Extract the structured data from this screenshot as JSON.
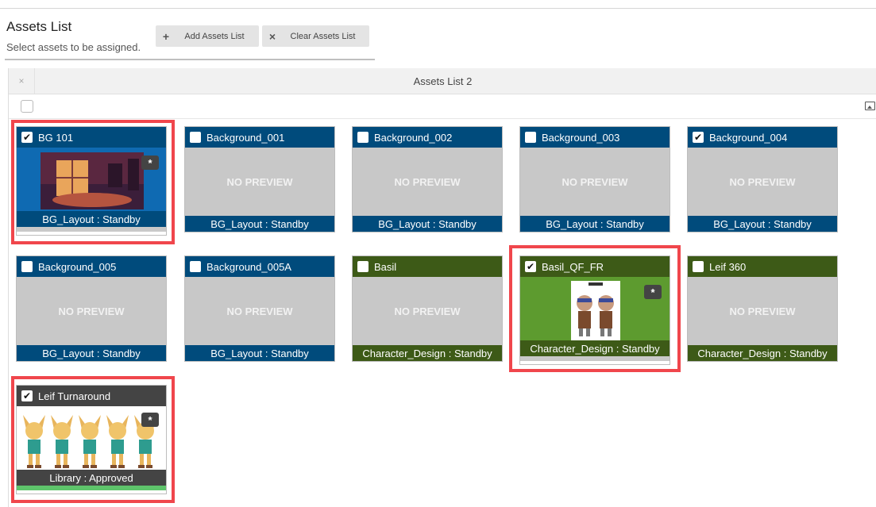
{
  "header": {
    "title": "Assets List",
    "subtitle": "Select assets to be assigned."
  },
  "buttons": {
    "add": {
      "icon": "plus-icon",
      "label": "Add Assets List"
    },
    "clear": {
      "icon": "close-icon",
      "label": "Clear Assets List"
    }
  },
  "panel": {
    "close_glyph": "×",
    "title": "Assets List 2"
  },
  "colors": {
    "background_group": "#004b7c",
    "character_group": "#3d5a17",
    "library_group": "#444444",
    "selection_highlight": "#f0464c",
    "approved_bar": "#5ec46b",
    "no_preview_bg": "#c8c8c8"
  },
  "no_preview_text": "NO PREVIEW",
  "star_glyph": "*",
  "check_glyph": "✔",
  "cards": [
    {
      "name": "BG 101",
      "status": "BG_Layout : Standby",
      "checked": true,
      "preview": "image",
      "highlighted": true
    },
    {
      "name": "Background_001",
      "status": "BG_Layout : Standby",
      "checked": false,
      "preview": "none"
    },
    {
      "name": "Background_002",
      "status": "BG_Layout : Standby",
      "checked": false,
      "preview": "none"
    },
    {
      "name": "Background_003",
      "status": "BG_Layout : Standby",
      "checked": false,
      "preview": "none"
    },
    {
      "name": "Background_004",
      "status": "BG_Layout : Standby",
      "checked": true,
      "preview": "none"
    },
    {
      "name": "Background_005",
      "status": "BG_Layout : Standby",
      "checked": false,
      "preview": "none"
    },
    {
      "name": "Background_005A",
      "status": "BG_Layout : Standby",
      "checked": false,
      "preview": "none"
    },
    {
      "name": "Basil",
      "status": "Character_Design : Standby",
      "checked": false,
      "preview": "none"
    },
    {
      "name": "Basil_QF_FR",
      "status": "Character_Design : Standby",
      "checked": true,
      "preview": "image",
      "highlighted": true
    },
    {
      "name": "Leif 360",
      "status": "Character_Design : Standby",
      "checked": false,
      "preview": "none"
    },
    {
      "name": "Leif Turnaround",
      "status": "Library : Approved",
      "checked": true,
      "preview": "image",
      "highlighted": true
    }
  ]
}
